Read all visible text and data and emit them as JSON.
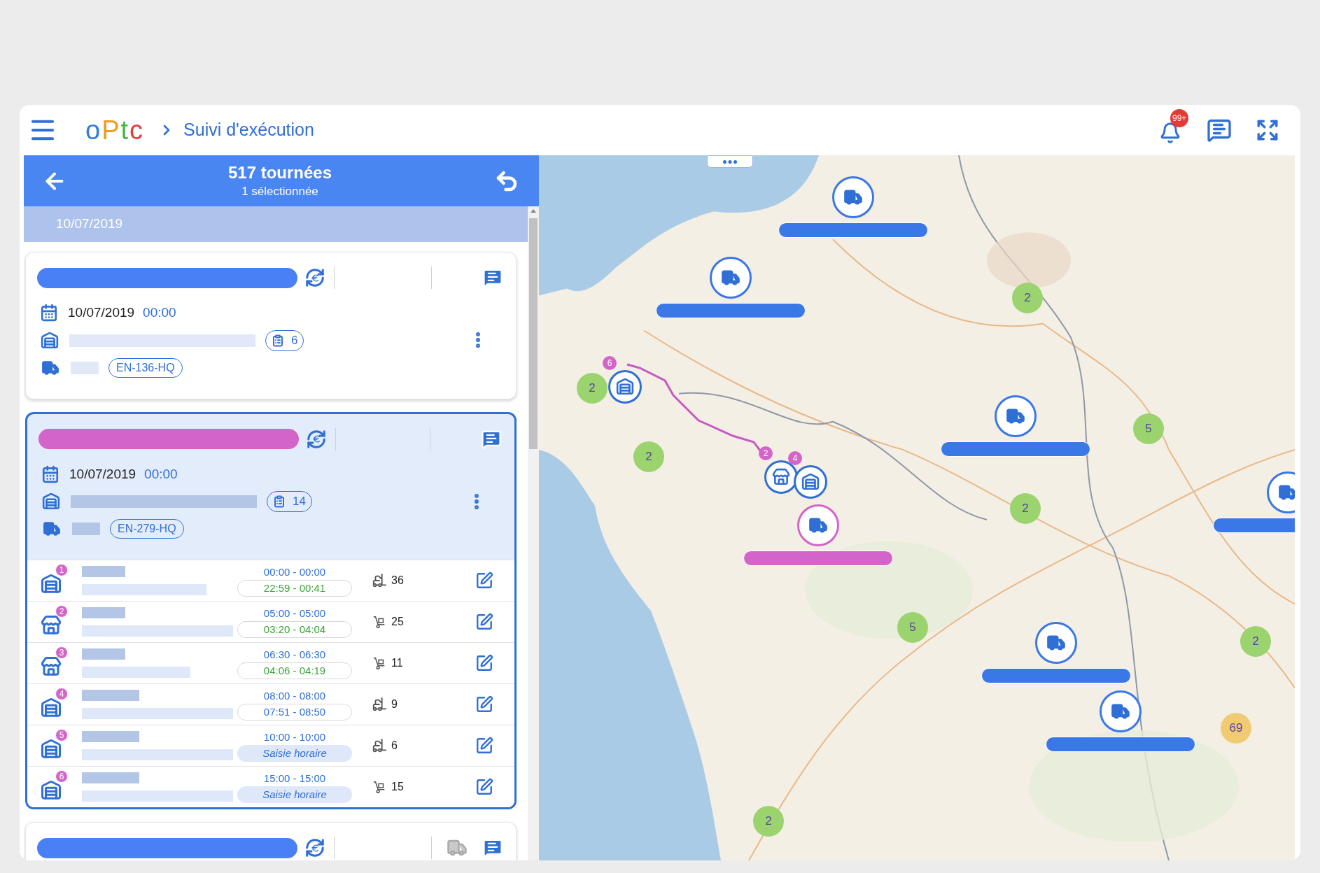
{
  "header": {
    "logo": "oPtc",
    "breadcrumb_title": "Suivi d'exécution",
    "notification_badge": "99+"
  },
  "panel": {
    "title": "517 tournées",
    "subtitle": "1 sélectionnée",
    "date_group": "10/07/2019"
  },
  "tours": [
    {
      "color": "#4a80f5",
      "selected": false,
      "vehicle_idle": false,
      "date": "10/07/2019",
      "time": "00:00",
      "orders": "6",
      "plate": "EN-136-HQ"
    },
    {
      "color": "#d465c8",
      "selected": true,
      "vehicle_idle": false,
      "date": "10/07/2019",
      "time": "00:00",
      "orders": "14",
      "plate": "EN-279-HQ",
      "stops": [
        {
          "number": "1",
          "planned": "00:00 - 00:00",
          "kind": "actual",
          "on_time": true,
          "actual": "22:59 - 00:41",
          "count": "36"
        },
        {
          "number": "2",
          "planned": "05:00 - 05:00",
          "kind": "actual",
          "on_time": true,
          "actual": "03:20 - 04:04",
          "count": "25"
        },
        {
          "number": "3",
          "planned": "06:30 - 06:30",
          "kind": "actual",
          "on_time": true,
          "actual": "04:06 - 04:19",
          "count": "11"
        },
        {
          "number": "4",
          "planned": "08:00 - 08:00",
          "kind": "actual",
          "on_time": false,
          "actual": "07:51 - 08:50",
          "count": "9"
        },
        {
          "number": "5",
          "planned": "10:00 - 10:00",
          "kind": "prompt",
          "prompt": "Saisie horaire",
          "count": "6"
        },
        {
          "number": "6",
          "planned": "15:00 - 15:00",
          "kind": "prompt",
          "prompt": "Saisie horaire",
          "count": "15"
        }
      ]
    },
    {
      "color": "#4a80f5",
      "selected": false,
      "vehicle_idle": true
    }
  ],
  "map": {
    "kind": "picture",
    "trucks": [
      {
        "color": "#3b78e7"
      },
      {
        "color": "#3b78e7"
      },
      {
        "color": "#3b78e7"
      },
      {
        "color": "#3b78e7"
      },
      {
        "color": "#3b78e7"
      },
      {
        "color": "#d465c8"
      },
      {
        "color": "#3b78e7"
      }
    ],
    "clusters": [
      {
        "count": "2",
        "color": "#9bd46e"
      },
      {
        "count": "2",
        "color": "#9bd46e"
      },
      {
        "count": "2",
        "color": "#9bd46e"
      },
      {
        "count": "5",
        "color": "#9bd46e"
      },
      {
        "count": "2",
        "color": "#9bd46e"
      },
      {
        "count": "5",
        "color": "#9bd46e"
      },
      {
        "count": "2",
        "color": "#9bd46e"
      },
      {
        "count": "2",
        "color": "#9bd46e"
      },
      {
        "count": "69",
        "color": "#f0cb73"
      }
    ],
    "stop_markers": [
      {
        "kind": "warehouse",
        "number": "6"
      },
      {
        "kind": "store",
        "number": "2"
      },
      {
        "kind": "warehouse",
        "number": "4"
      }
    ]
  }
}
